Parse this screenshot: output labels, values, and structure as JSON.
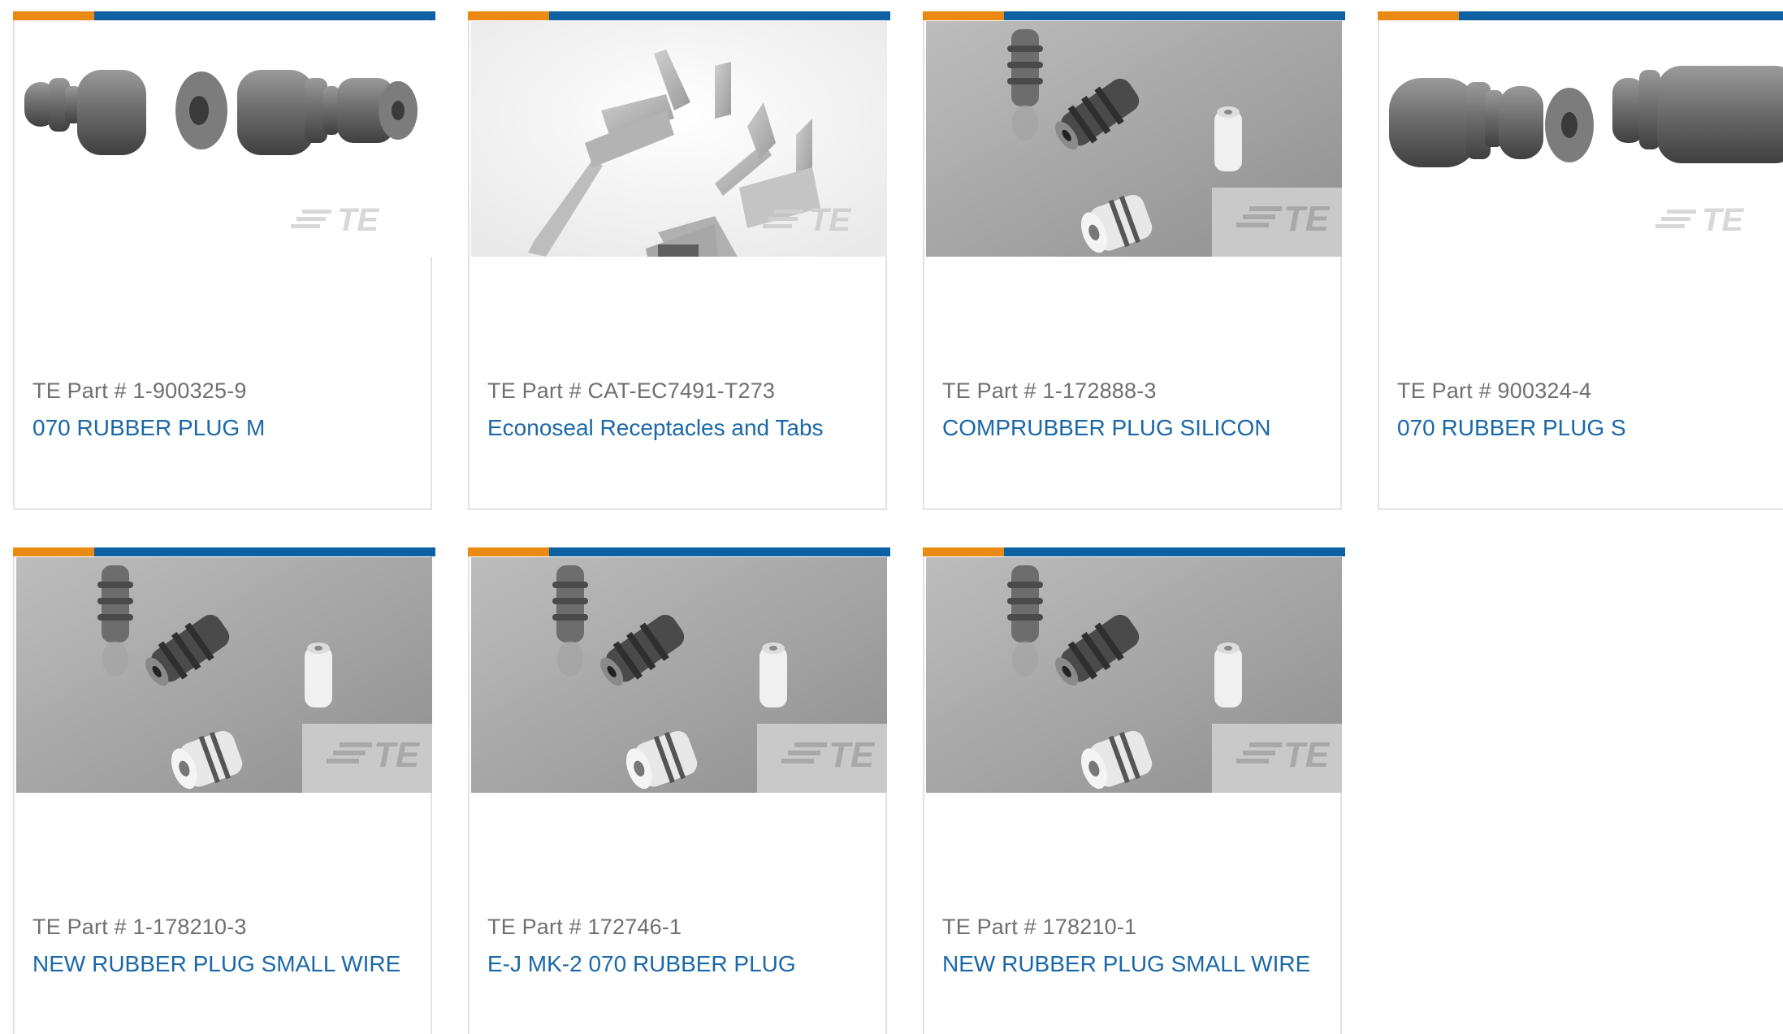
{
  "colors": {
    "accent_orange": "#ea8a13",
    "accent_blue": "#0d60a2",
    "part_number_text": "#6f6f6f",
    "product_link": "#1a68a8",
    "card_border": "#e3e3e3"
  },
  "products": [
    {
      "part_number": "TE Part # 1-900325-9",
      "name": "070 RUBBER PLUG M",
      "image_icon": "rubber-plug-pair-icon",
      "watermark": "TE"
    },
    {
      "part_number": "TE Part # CAT-EC7491-T273",
      "name": "Econoseal Receptacles and Tabs",
      "image_icon": "receptacle-tab-icon",
      "watermark": "TE"
    },
    {
      "part_number": "TE Part # 1-172888-3",
      "name": "COMPRUBBER PLUG SILICON",
      "image_icon": "assorted-plugs-icon",
      "watermark": "TE"
    },
    {
      "part_number": "TE Part # 900324-4",
      "name": "070 RUBBER PLUG S",
      "image_icon": "rubber-plug-pair-icon",
      "watermark": "TE"
    },
    {
      "part_number": "TE Part # 1-178210-3",
      "name": "NEW RUBBER PLUG SMALL WIRE",
      "image_icon": "assorted-plugs-icon",
      "watermark": "TE"
    },
    {
      "part_number": "TE Part # 172746-1",
      "name": "E-J MK-2 070 RUBBER PLUG",
      "image_icon": "assorted-plugs-icon",
      "watermark": "TE"
    },
    {
      "part_number": "TE Part # 178210-1",
      "name": "NEW RUBBER PLUG SMALL WIRE",
      "image_icon": "assorted-plugs-icon",
      "watermark": "TE"
    }
  ]
}
